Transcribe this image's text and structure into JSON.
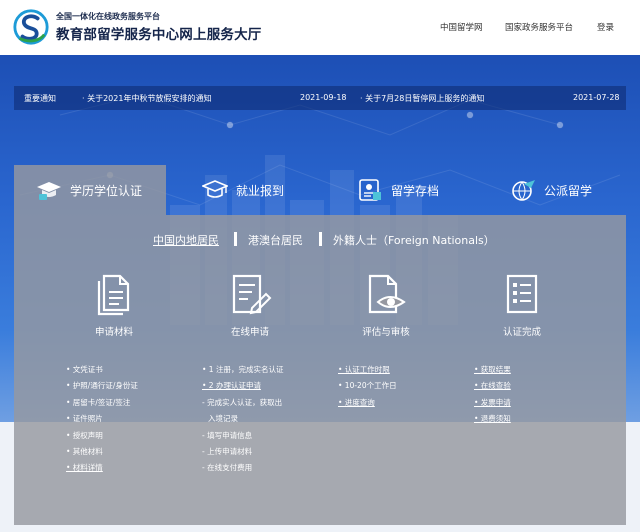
{
  "header": {
    "brand_small": "全国一体化在线政务服务平台",
    "brand_big": "教育部留学服务中心网上服务大厅",
    "nav": [
      "中国留学网",
      "国家政务服务平台",
      "登录"
    ]
  },
  "notice": {
    "label": "重要通知",
    "items": [
      {
        "title": "· 关于2021年中秋节放假安排的通知",
        "date": "2021-09-18"
      },
      {
        "title": "· 关于7月28日暂停网上服务的通知",
        "date": "2021-07-28"
      }
    ]
  },
  "tabs": [
    {
      "label": "学历学位认证",
      "icon": "graduation-cap-icon"
    },
    {
      "label": "就业报到",
      "icon": "academic-cap-icon"
    },
    {
      "label": "留学存档",
      "icon": "id-card-icon"
    },
    {
      "label": "公派留学",
      "icon": "airplane-globe-icon"
    }
  ],
  "subtabs": [
    "中国内地居民",
    "港澳台居民",
    "外籍人士（Foreign Nationals）"
  ],
  "steps": [
    {
      "title": "申请材料",
      "icon": "documents-icon"
    },
    {
      "title": "在线申请",
      "icon": "edit-form-icon"
    },
    {
      "title": "评估与审核",
      "icon": "file-review-icon"
    },
    {
      "title": "认证完成",
      "icon": "checklist-icon"
    }
  ],
  "columns": [
    [
      "• 文凭证书",
      "• 护照/通行证/身份证",
      "• 居留卡/签证/签注",
      "• 证件照片",
      "• 授权声明",
      "• 其他材料",
      "• 材料详情"
    ],
    [
      "• 1 注册，完成实名认证",
      "• 2 办理认证申请",
      "- 完成实人认证，获取出",
      "入境记录",
      "- 填写申请信息",
      "- 上传申请材料",
      "- 在线支付费用"
    ],
    [
      "• 认证工作时限",
      "• 10-20个工作日",
      "• 进度查询"
    ],
    [
      "• 获取结果",
      "• 在线查验",
      "• 发票申请",
      "• 退费须知"
    ]
  ]
}
